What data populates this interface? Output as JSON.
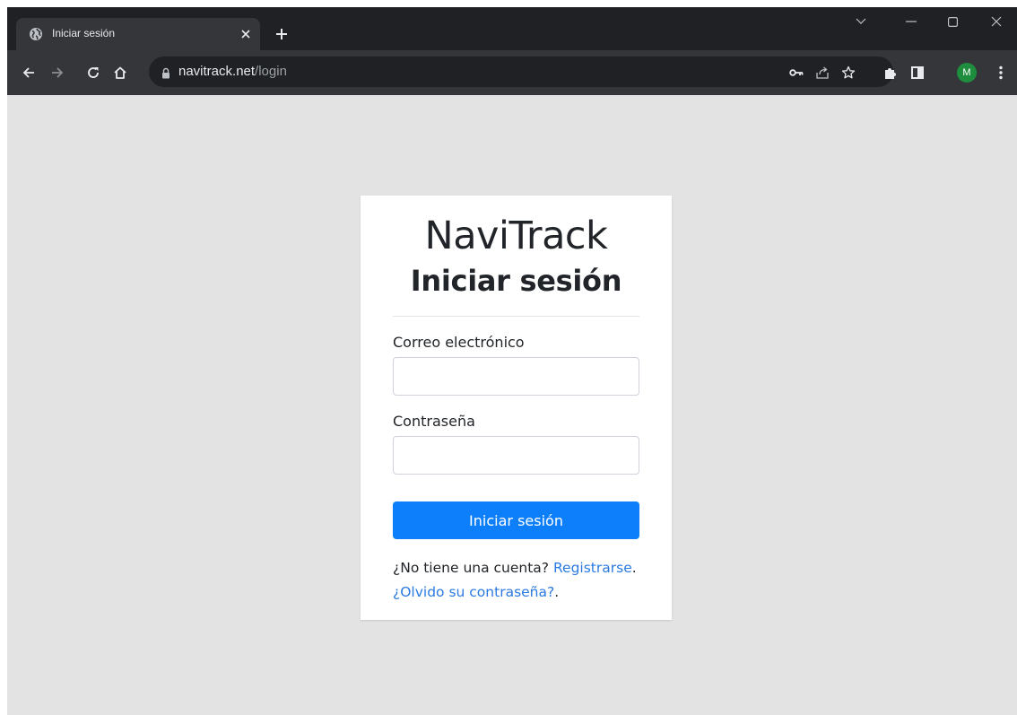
{
  "browser": {
    "tab": {
      "title": "Iniciar sesión",
      "favicon": "globe-icon"
    },
    "address": {
      "host": "navitrack.net",
      "path": "/login"
    },
    "profile_initial": "M",
    "colors": {
      "frame": "#202124",
      "toolbar": "#35363a",
      "avatar": "#1e8e3e"
    }
  },
  "page": {
    "background": "#e3e3e3",
    "brand": "NaviTrack",
    "heading": "Iniciar sesión",
    "email": {
      "label": "Correo electrónico",
      "value": "",
      "placeholder": ""
    },
    "password": {
      "label": "Contraseña",
      "value": "",
      "placeholder": ""
    },
    "submit_label": "Iniciar sesión",
    "submit_color": "#0d7ffb",
    "signup_prompt": "¿No tiene una cuenta?",
    "signup_link": "Registrarse",
    "signup_suffix": ".",
    "forgot_link": "¿Olvido su contraseña?",
    "forgot_suffix": "."
  }
}
